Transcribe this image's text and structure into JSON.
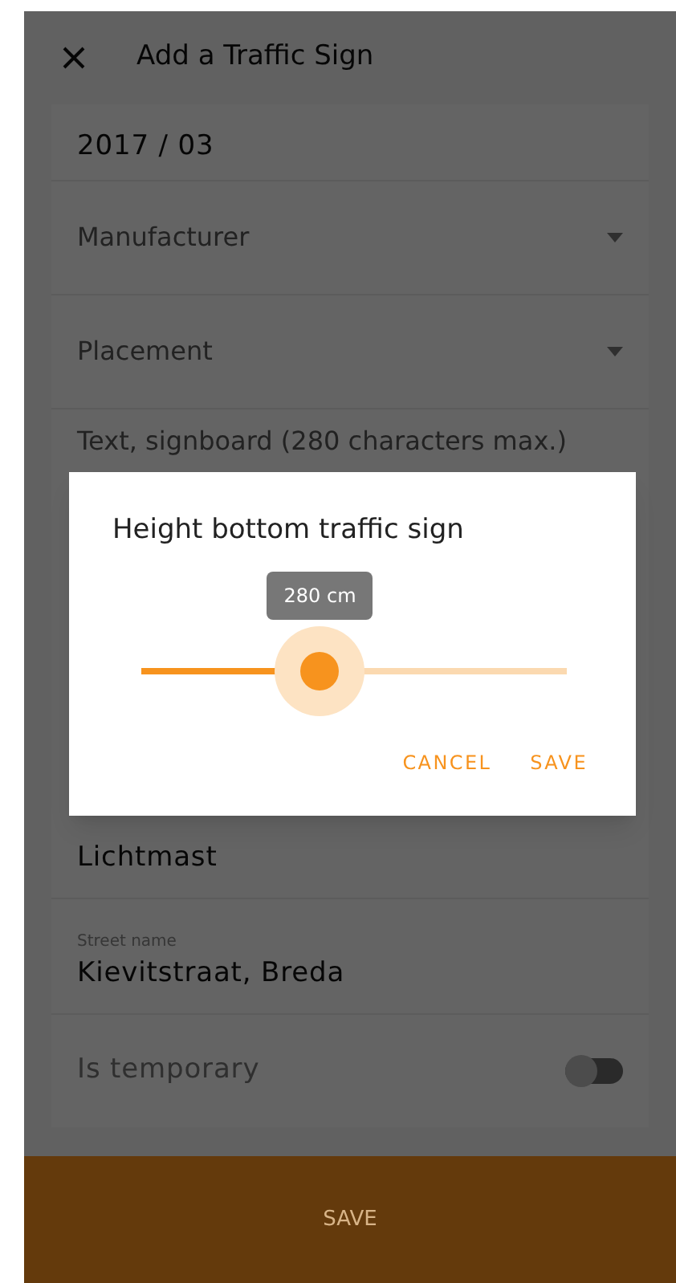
{
  "header": {
    "title": "Add a Traffic Sign"
  },
  "fields": [
    {
      "kind": "value",
      "value": "2017 / 03"
    },
    {
      "kind": "dropdown",
      "placeholder": "Manufacturer"
    },
    {
      "kind": "dropdown",
      "placeholder": "Placement"
    },
    {
      "kind": "text",
      "placeholder": "Text, signboard (280 characters max.)"
    },
    {
      "kind": "value",
      "value": "Lichtmast"
    },
    {
      "kind": "value",
      "label": "Street name",
      "value": "Kievitstraat, Breda"
    },
    {
      "kind": "toggle",
      "label": "Is temporary",
      "on": false
    }
  ],
  "bottom_bar": {
    "button": "SAVE"
  },
  "dialog": {
    "title": "Height bottom traffic sign",
    "slider": {
      "level": 0.42,
      "reading": "280 cm"
    },
    "buttons": [
      "CANCEL",
      "SAVE"
    ]
  }
}
